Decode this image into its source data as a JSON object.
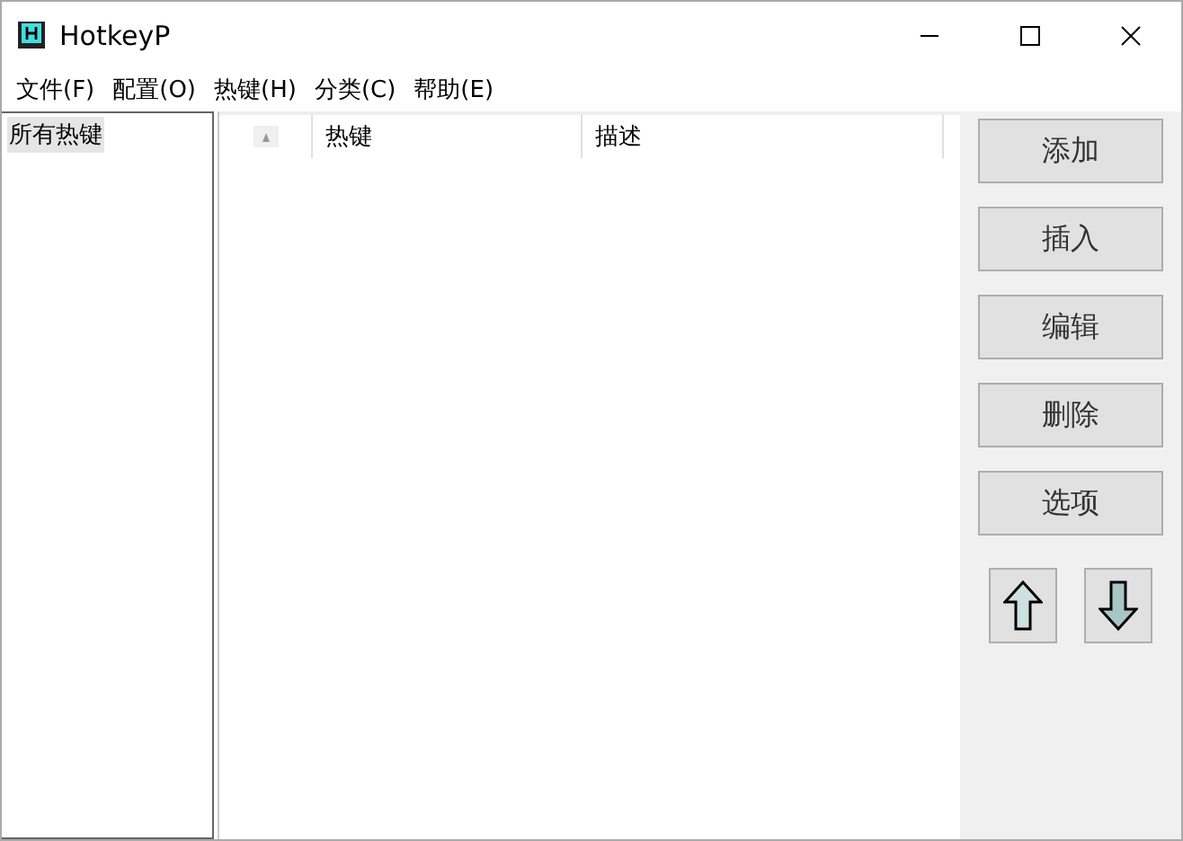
{
  "window": {
    "title": "HotkeyP"
  },
  "menu": [
    "文件(F)",
    "配置(O)",
    "热键(H)",
    "分类(C)",
    "帮助(E)"
  ],
  "tree": {
    "items": [
      {
        "label": "所有热键",
        "selected": true
      }
    ]
  },
  "table": {
    "columns": [
      {
        "kind": "sort"
      },
      {
        "kind": "text",
        "label": "热键"
      },
      {
        "kind": "text",
        "label": "描述"
      }
    ]
  },
  "buttons": [
    "添加",
    "插入",
    "编辑",
    "删除",
    "选项"
  ],
  "move_buttons": [
    {
      "kind": "up"
    },
    {
      "kind": "down"
    }
  ]
}
